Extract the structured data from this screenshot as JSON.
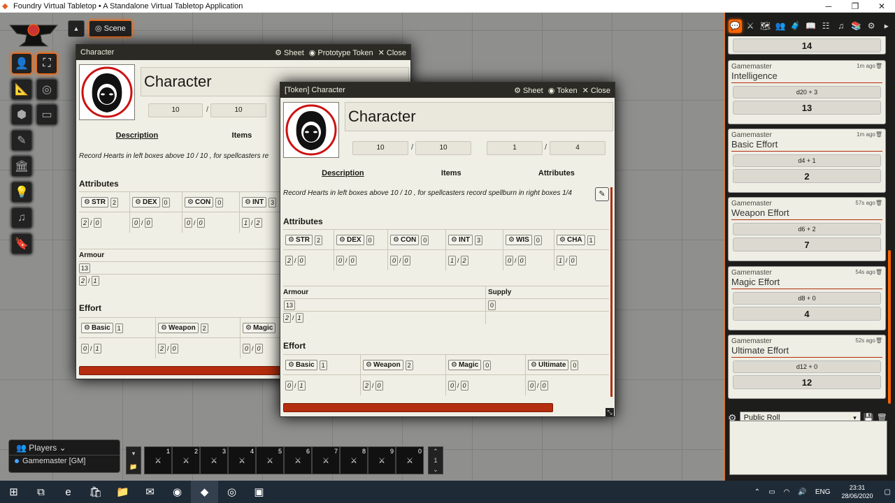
{
  "window": {
    "title": "Foundry Virtual Tabletop • A Standalone Virtual Tabletop Application",
    "minimize": "─",
    "maximize": "❐",
    "close": "✕"
  },
  "nav": {
    "toggle": "▲",
    "scene": "Scene"
  },
  "sheet1": {
    "title": "Character",
    "sheet_btn": "Sheet",
    "proto_btn": "Prototype Token",
    "close_btn": "Close",
    "name": "Character",
    "hp": "10",
    "hp_max": "10",
    "tabs": [
      "Description",
      "Items"
    ],
    "description": "Record Hearts in left boxes above 10 / 10 , for spellcasters re",
    "attributes_label": "Attributes",
    "attributes": [
      {
        "label": "STR",
        "val": "2",
        "a": "2",
        "b": "0"
      },
      {
        "label": "DEX",
        "val": "0",
        "a": "0",
        "b": "0"
      },
      {
        "label": "CON",
        "val": "0",
        "a": "0",
        "b": "0"
      },
      {
        "label": "INT",
        "val": "3",
        "a": "1",
        "b": "2"
      }
    ],
    "armour_label": "Armour",
    "armour": "13",
    "armour_a": "2",
    "armour_b": "1",
    "effort_label": "Effort",
    "efforts": [
      {
        "label": "Basic",
        "val": "1",
        "a": "0",
        "b": "1"
      },
      {
        "label": "Weapon",
        "val": "2",
        "a": "2",
        "b": "0"
      },
      {
        "label": "Magic",
        "val": "",
        "a": "0",
        "b": "0"
      }
    ]
  },
  "sheet2": {
    "title": "[Token] Character",
    "sheet_btn": "Sheet",
    "token_btn": "Token",
    "close_btn": "Close",
    "name": "Character",
    "hp": "10",
    "hp_max": "10",
    "sp": "1",
    "sp_max": "4",
    "tabs": [
      "Description",
      "Items",
      "Attributes"
    ],
    "description": "Record Hearts in left boxes above 10 / 10 , for spellcasters record spellburn in right boxes 1/4",
    "attributes_label": "Attributes",
    "attributes": [
      {
        "label": "STR",
        "val": "2",
        "a": "2",
        "b": "0"
      },
      {
        "label": "DEX",
        "val": "0",
        "a": "0",
        "b": "0"
      },
      {
        "label": "CON",
        "val": "0",
        "a": "0",
        "b": "0"
      },
      {
        "label": "INT",
        "val": "3",
        "a": "1",
        "b": "2"
      },
      {
        "label": "WIS",
        "val": "0",
        "a": "0",
        "b": "0"
      },
      {
        "label": "CHA",
        "val": "1",
        "a": "1",
        "b": "0"
      }
    ],
    "armour_label": "Armour",
    "supply_label": "Supply",
    "armour": "13",
    "supply": "0",
    "armour_a": "2",
    "armour_b": "1",
    "effort_label": "Effort",
    "efforts": [
      {
        "label": "Basic",
        "val": "1",
        "a": "0",
        "b": "1"
      },
      {
        "label": "Weapon",
        "val": "2",
        "a": "2",
        "b": "0"
      },
      {
        "label": "Magic",
        "val": "0",
        "a": "0",
        "b": "0"
      },
      {
        "label": "Ultimate",
        "val": "0",
        "a": "0",
        "b": "0"
      }
    ]
  },
  "chat": {
    "top_total": "14",
    "messages": [
      {
        "author": "Gamemaster",
        "time": "1m ago",
        "flavor": "Intelligence",
        "formula": "d20 + 3",
        "total": "13"
      },
      {
        "author": "Gamemaster",
        "time": "1m ago",
        "flavor": "Basic Effort",
        "formula": "d4 + 1",
        "total": "2"
      },
      {
        "author": "Gamemaster",
        "time": "57s ago",
        "flavor": "Weapon Effort",
        "formula": "d6 + 2",
        "total": "7"
      },
      {
        "author": "Gamemaster",
        "time": "54s ago",
        "flavor": "Magic Effort",
        "formula": "d8 + 0",
        "total": "4"
      },
      {
        "author": "Gamemaster",
        "time": "52s ago",
        "flavor": "Ultimate Effort",
        "formula": "d12 + 0",
        "total": "12"
      }
    ],
    "roll_mode": "Public Roll"
  },
  "players": {
    "header": "Players",
    "user": "Gamemaster [GM]"
  },
  "hotbar": {
    "slots": [
      "1",
      "2",
      "3",
      "4",
      "5",
      "6",
      "7",
      "8",
      "9",
      "0"
    ],
    "page": "1"
  },
  "taskbar": {
    "lang": "ENG",
    "time": "23:31",
    "date": "28/06/2020"
  },
  "colors": {
    "accent": "#ff6400",
    "bar": "#b32d0e",
    "parchment": "#f0efe5"
  }
}
